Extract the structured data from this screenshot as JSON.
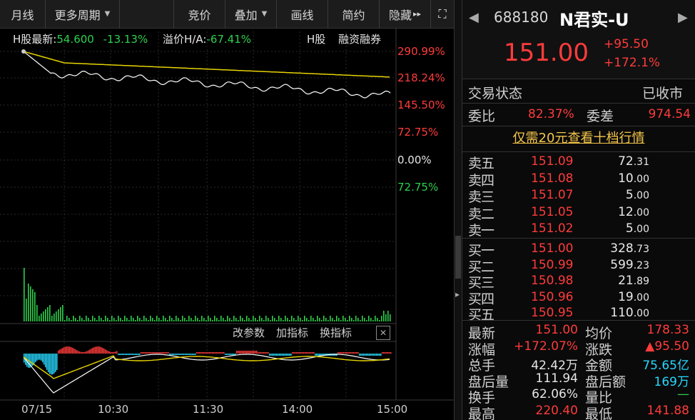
{
  "toolbar": {
    "buttons": [
      {
        "label": "月线",
        "caret": false
      },
      {
        "label": "更多周期",
        "caret": true
      },
      {
        "label": "竞价",
        "caret": false
      },
      {
        "label": "叠加",
        "caret": true
      },
      {
        "label": "画线",
        "caret": false
      },
      {
        "label": "简约",
        "caret": false
      },
      {
        "label": "隐藏",
        "caret": false
      }
    ],
    "more_glyph": "▸▸",
    "fullscreen_glyph": "⛶"
  },
  "chart_header": {
    "h_latest_label": "H股最新:",
    "h_latest_value": "54.600",
    "h_change": "-13.13%",
    "premium_label": "溢价H/A:",
    "premium_value": "-67.41%",
    "h_label": "H股",
    "margin_label": "融资融券"
  },
  "axis": {
    "pct_labels": [
      "290.99%",
      "218.24%",
      "145.50%",
      "72.75%",
      "0.00%",
      "72.75%"
    ],
    "time_labels": [
      "07/15",
      "10:30",
      "11:30",
      "14:00",
      "15:00"
    ]
  },
  "indicator": {
    "change_params": "改参数",
    "add_indicator": "加指标",
    "switch_indicator": "换指标",
    "close_glyph": "✕"
  },
  "stock": {
    "code": "688180",
    "name": "N君实-U",
    "price": "151.00",
    "change": "+95.50",
    "change_pct": "+172.1%"
  },
  "status": {
    "trade_state_label": "交易状态",
    "trade_state_value": "已收市",
    "wei_bi_label": "委比",
    "wei_bi_value": "82.37%",
    "wei_cha_label": "委差",
    "wei_cha_value": "974.54"
  },
  "promo_text": "仅需20元查看十档行情",
  "order_book": {
    "asks": [
      {
        "label": "卖五",
        "price": "151.09",
        "vol_int": "72",
        "vol_dec": ".31"
      },
      {
        "label": "卖四",
        "price": "151.08",
        "vol_int": "10",
        "vol_dec": ".00"
      },
      {
        "label": "卖三",
        "price": "151.07",
        "vol_int": "5",
        "vol_dec": ".00"
      },
      {
        "label": "卖二",
        "price": "151.05",
        "vol_int": "12",
        "vol_dec": ".00"
      },
      {
        "label": "卖一",
        "price": "151.02",
        "vol_int": "5",
        "vol_dec": ".00"
      }
    ],
    "bids": [
      {
        "label": "买一",
        "price": "151.00",
        "vol_int": "328",
        "vol_dec": ".73"
      },
      {
        "label": "买二",
        "price": "150.99",
        "vol_int": "599",
        "vol_dec": ".23"
      },
      {
        "label": "买三",
        "price": "150.98",
        "vol_int": "21",
        "vol_dec": ".89"
      },
      {
        "label": "买四",
        "price": "150.96",
        "vol_int": "19",
        "vol_dec": ".00"
      },
      {
        "label": "买五",
        "price": "150.95",
        "vol_int": "110",
        "vol_dec": ".00"
      }
    ]
  },
  "stats": [
    {
      "l1": "最新",
      "v1": "151.00",
      "c1": "#ff3b3b",
      "l2": "均价",
      "v2": "178.33",
      "c2": "#ff3b3b"
    },
    {
      "l1": "涨幅",
      "v1": "+172.07%",
      "c1": "#ff3b3b",
      "l2": "涨跌",
      "v2": "▲95.50",
      "c2": "#ff3b3b"
    },
    {
      "l1": "总手",
      "v1": "42.42万",
      "c1": "#e6e6e6",
      "l2": "金额",
      "v2": "75.65亿",
      "c2": "#28d7ff"
    },
    {
      "l1": "盘后量",
      "v1": "111.94",
      "c1": "#e6e6e6",
      "l2": "盘后额",
      "v2": "169万",
      "c2": "#28d7ff"
    },
    {
      "l1": "换手",
      "v1": "62.06%",
      "c1": "#e6e6e6",
      "l2": "量比",
      "v2": "—",
      "c2": "#2ed04e"
    },
    {
      "l1": "最高",
      "v1": "220.40",
      "c1": "#ff3b3b",
      "l2": "最低",
      "v2": "141.88",
      "c2": "#ff3b3b"
    }
  ],
  "colors": {
    "up": "#ff3b3b",
    "down": "#2ed04e",
    "price_line": "#ffffff",
    "avg_line": "#e8d400",
    "macd_pos": "#ff3b3b",
    "macd_neg": "#28d7ff"
  }
}
